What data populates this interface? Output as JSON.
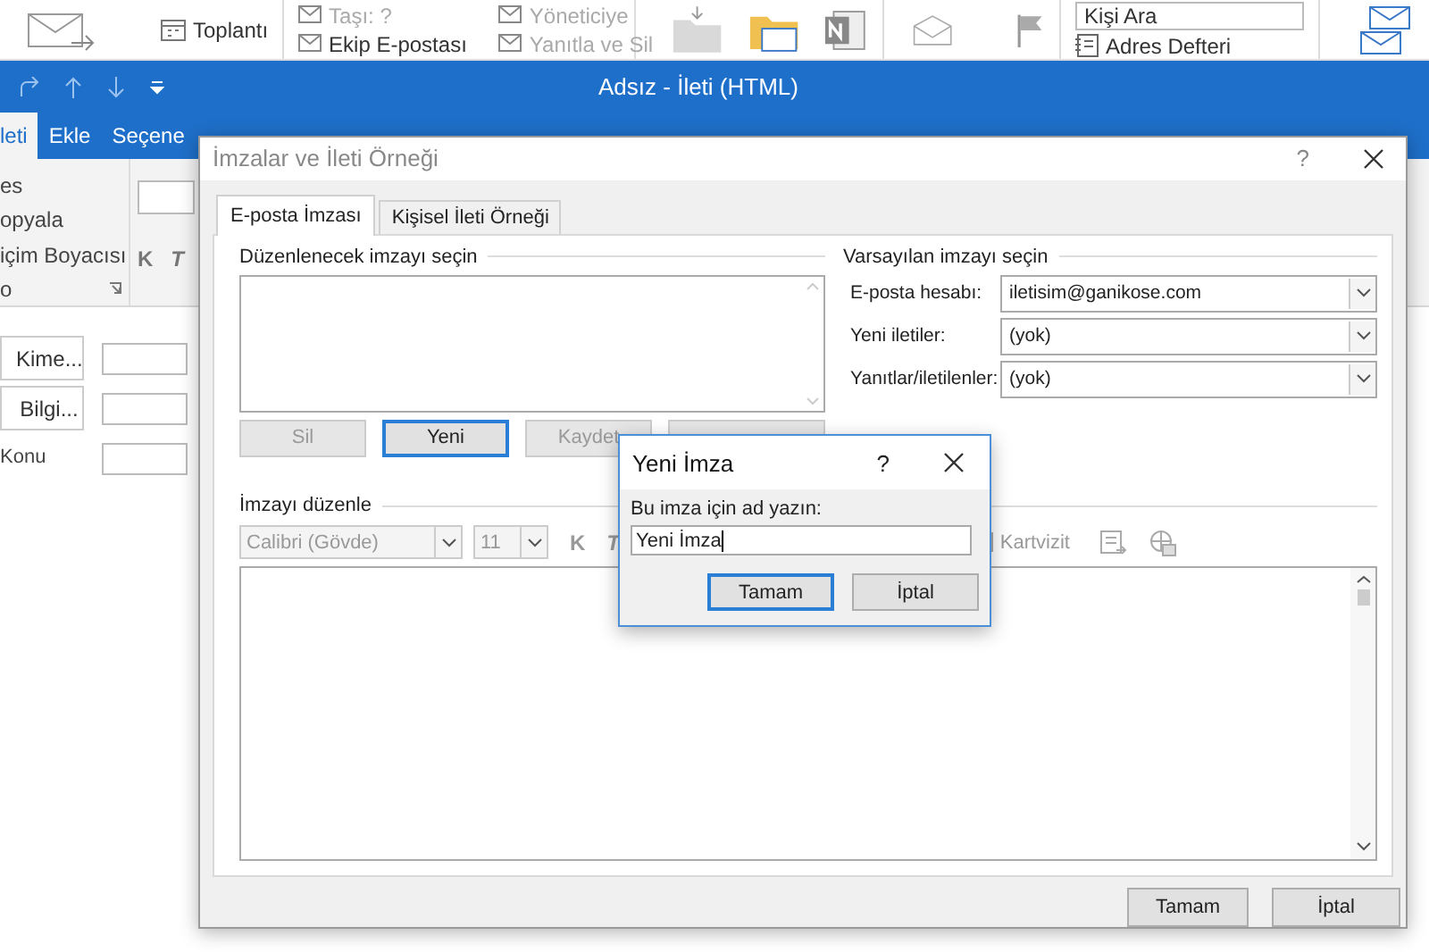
{
  "ribbon_strip": {
    "items": [
      {
        "kind": "icon-label",
        "label": "Toplantı",
        "disabled": false
      },
      {
        "kind": "text",
        "label": "Taşı: ?",
        "disabled": true
      },
      {
        "kind": "text",
        "label": "Ekip E-postası",
        "disabled": false
      },
      {
        "kind": "text",
        "label": "Yöneticiye",
        "disabled": true
      },
      {
        "kind": "text",
        "label": "Yanıtla ve Sil",
        "disabled": true
      }
    ],
    "search": {
      "value": "Kişi Ara"
    },
    "address_book": "Adres Defteri"
  },
  "window": {
    "title": "Adsız  -  İleti (HTML)"
  },
  "tabs": [
    {
      "label": "leti",
      "selected": true
    },
    {
      "label": "Ekle",
      "selected": false
    },
    {
      "label": "Seçene",
      "selected": false
    }
  ],
  "clipboard": {
    "items": [
      "es",
      "opyala",
      "içim Boyacısı"
    ],
    "group": "o",
    "bold": "K",
    "italic": "T"
  },
  "compose": {
    "to": "Kime...",
    "cc": "Bilgi...",
    "subject": "Konu"
  },
  "dialog": {
    "title": "İmzalar ve İleti Örneği",
    "help": "?",
    "tabs": [
      {
        "label": "E-posta İmzası",
        "selected": true
      },
      {
        "label": "Kişisel İleti Örneği",
        "selected": false
      }
    ],
    "choose_group": "Düzenlenecek imzayı seçin",
    "buttons": [
      {
        "label": "Sil",
        "disabled": true,
        "focused": false
      },
      {
        "label": "Yeni",
        "disabled": false,
        "focused": true
      },
      {
        "label": "Kaydet",
        "disabled": true,
        "focused": false
      },
      {
        "disabled": true,
        "focused": false
      }
    ],
    "default_group": "Varsayılan imzayı seçin",
    "defaults": [
      {
        "label": "E-posta hesabı:",
        "value": "iletisim@ganikose.com"
      },
      {
        "label": "Yeni iletiler:",
        "value": "(yok)"
      },
      {
        "label": "Yanıtlar/iletilenler:",
        "value": "(yok)"
      }
    ],
    "edit_group": "İmzayı düzenle",
    "font": "Calibri (Gövde)",
    "size": "11",
    "bold": "K",
    "italic": "T",
    "business_card": "Kartvizit",
    "footer": [
      "Tamam",
      "İptal"
    ]
  },
  "name_dialog": {
    "title": "Yeni İmza",
    "help": "?",
    "prompt": "Bu imza için ad yazın:",
    "value": "Yeni İmza",
    "buttons": [
      {
        "label": "Tamam",
        "focused": true
      },
      {
        "label": "İptal",
        "focused": false
      }
    ]
  }
}
